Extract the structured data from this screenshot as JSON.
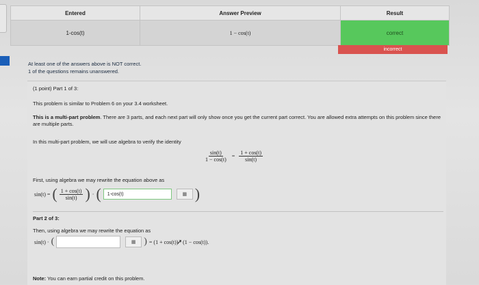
{
  "results_table": {
    "headers": [
      "Entered",
      "Answer Preview",
      "Result"
    ],
    "row": {
      "entered": "1-cos(t)",
      "preview": "1 − cos(t)",
      "result": "correct"
    },
    "badge": "incorrect"
  },
  "summary": {
    "line1": "At least one of the answers above is NOT correct.",
    "line2": "1 of the questions remains unanswered."
  },
  "problem": {
    "part1_header": "(1 point) Part 1 of 3:",
    "similar": "This problem is similar to Problem 6 on your 3.4 worksheet.",
    "multi_bold": "This is a multi-part problem",
    "multi_rest": ". There are 3 parts, and each next part will only show once you get the current part correct. You are allowed extra attempts on this problem since there are multiple parts.",
    "identity_intro": "In this multi-part problem, we will use algebra to verify the identity",
    "identity_left_num": "sin(t)",
    "identity_left_den": "1 − cos(t)",
    "identity_eq": "=",
    "identity_right_num": "1 + cos(t)",
    "identity_right_den": "sin(t)",
    "rewrite1": "First, using algebra we may rewrite the equation above as",
    "eq1_lhs": "sin(t) =",
    "eq1_frac_num": "1 + cos(t)",
    "eq1_frac_den": "sin(t)",
    "eq1_dot": "·",
    "eq1_answer": "1-cos(t)",
    "grid_icon_label": "▦",
    "part2_header": "Part 2 of 3:",
    "rewrite2": "Then, using algebra we may rewrite the equation as",
    "eq2_lhs": "sin(t) ·",
    "eq2_rhs": "= (1 + cos(t)) · (1 − cos(t)).",
    "note_bold": "Note:",
    "note_rest": " You can earn partial credit on this problem."
  }
}
